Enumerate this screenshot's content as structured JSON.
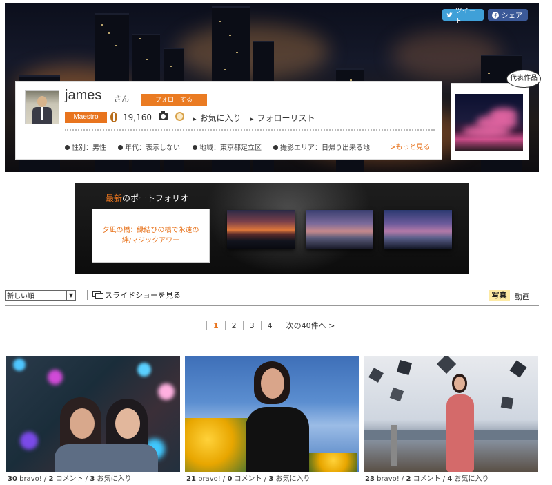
{
  "share": {
    "tweet": "ツイート",
    "share": "シェア"
  },
  "profile": {
    "username": "james",
    "honorific": "さん",
    "follow_label": "フォローする",
    "rank": "Maestro",
    "count": "19,160",
    "favorites_link": "お気に入り",
    "follow_list_link": "フォローリスト",
    "info": [
      "性別：男性",
      "年代：表示しない",
      "地域：東京都足立区",
      "撮影エリア：日帰り出来る地"
    ],
    "more_link": ">もっと見る",
    "representative_label": "代表作品"
  },
  "portfolio": {
    "title_hl": "最新",
    "title_rest": "のポートフォリオ",
    "caption": "夕凪の橋：縁結びの橋で永遠の絆/マジックアワー"
  },
  "toolbar": {
    "sort_value": "新しい順",
    "slideshow_label": "スライドショーを見る",
    "tab_photo": "写真",
    "tab_video": "動画"
  },
  "pager": {
    "pages": [
      "1",
      "2",
      "3",
      "4"
    ],
    "next": "次の40件へ >"
  },
  "cards": [
    {
      "bravo": "30",
      "bravo_label": " bravo!",
      "comments": "2",
      "comment_label": " コメント",
      "favs": "3",
      "fav_label": " お気に入り"
    },
    {
      "bravo": "21",
      "bravo_label": " bravo!",
      "comments": "0",
      "comment_label": " コメント",
      "favs": "3",
      "fav_label": " お気に入り"
    },
    {
      "bravo": "23",
      "bravo_label": " bravo!",
      "comments": "2",
      "comment_label": " コメント",
      "favs": "4",
      "fav_label": " お気に入り"
    }
  ],
  "colors": {
    "accent": "#e8741e",
    "twitter": "#3fa0d8",
    "facebook": "#3b5998",
    "tab_active": "#fdeaa4"
  }
}
